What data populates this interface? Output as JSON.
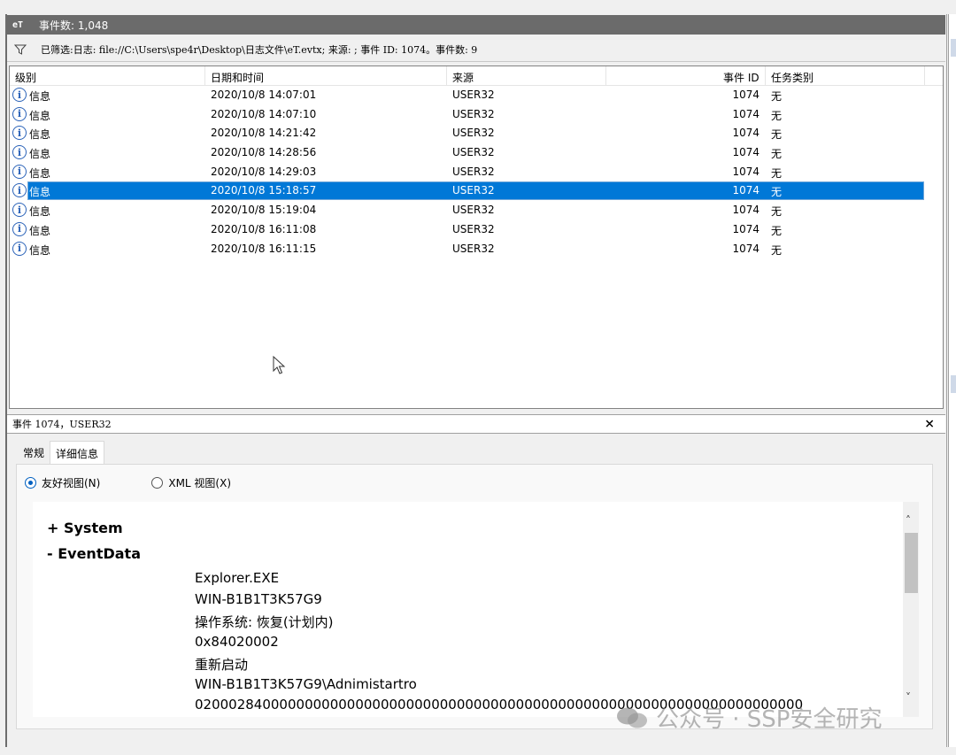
{
  "title_bar": {
    "app_icon": "eT",
    "event_count": "事件数: 1,048"
  },
  "filter": {
    "text": "已筛选:日志: file://C:\\Users\\spe4r\\Desktop\\日志文件\\eT.evtx; 来源: ; 事件 ID: 1074。事件数: 9"
  },
  "table": {
    "headers": {
      "level": "级别",
      "datetime": "日期和时间",
      "source": "来源",
      "event_id": "事件 ID",
      "task": "任务类别"
    },
    "rows": [
      {
        "level": "信息",
        "datetime": "2020/10/8 14:07:01",
        "source": "USER32",
        "event_id": "1074",
        "task": "无"
      },
      {
        "level": "信息",
        "datetime": "2020/10/8 14:07:10",
        "source": "USER32",
        "event_id": "1074",
        "task": "无"
      },
      {
        "level": "信息",
        "datetime": "2020/10/8 14:21:42",
        "source": "USER32",
        "event_id": "1074",
        "task": "无"
      },
      {
        "level": "信息",
        "datetime": "2020/10/8 14:28:56",
        "source": "USER32",
        "event_id": "1074",
        "task": "无"
      },
      {
        "level": "信息",
        "datetime": "2020/10/8 14:29:03",
        "source": "USER32",
        "event_id": "1074",
        "task": "无"
      },
      {
        "level": "信息",
        "datetime": "2020/10/8 15:18:57",
        "source": "USER32",
        "event_id": "1074",
        "task": "无"
      },
      {
        "level": "信息",
        "datetime": "2020/10/8 15:19:04",
        "source": "USER32",
        "event_id": "1074",
        "task": "无"
      },
      {
        "level": "信息",
        "datetime": "2020/10/8 16:11:08",
        "source": "USER32",
        "event_id": "1074",
        "task": "无"
      },
      {
        "level": "信息",
        "datetime": "2020/10/8 16:11:15",
        "source": "USER32",
        "event_id": "1074",
        "task": "无"
      }
    ],
    "selected_index": 5
  },
  "detail": {
    "header": "事件 1074，USER32",
    "close_label": "×",
    "tabs": [
      "常规",
      "详细信息"
    ],
    "active_tab": 1,
    "radio_friendly": "友好视图(N)",
    "radio_xml": "XML 视图(X)",
    "system_node": "+  System",
    "eventdata_node": "-  EventData",
    "eventdata": [
      "Explorer.EXE",
      "WIN-B1B1T3K57G9",
      "操作系统: 恢复(计划内)",
      "0x84020002",
      "重新启动",
      "WIN-B1B1T3K57G9\\Adnimistartro",
      "020002840000000000000000000000000000000000000000000000000000000000000000"
    ]
  },
  "watermark": "公众号 · SSP安全研究",
  "icons": {
    "info": "info-icon",
    "filter": "filter-icon",
    "cursor": "cursor-arrow-icon",
    "wechat": "wechat-icon"
  },
  "colors": {
    "selection": "#0078d7",
    "title_bar": "#6b6b6b",
    "info_icon": "#2a62b8"
  }
}
